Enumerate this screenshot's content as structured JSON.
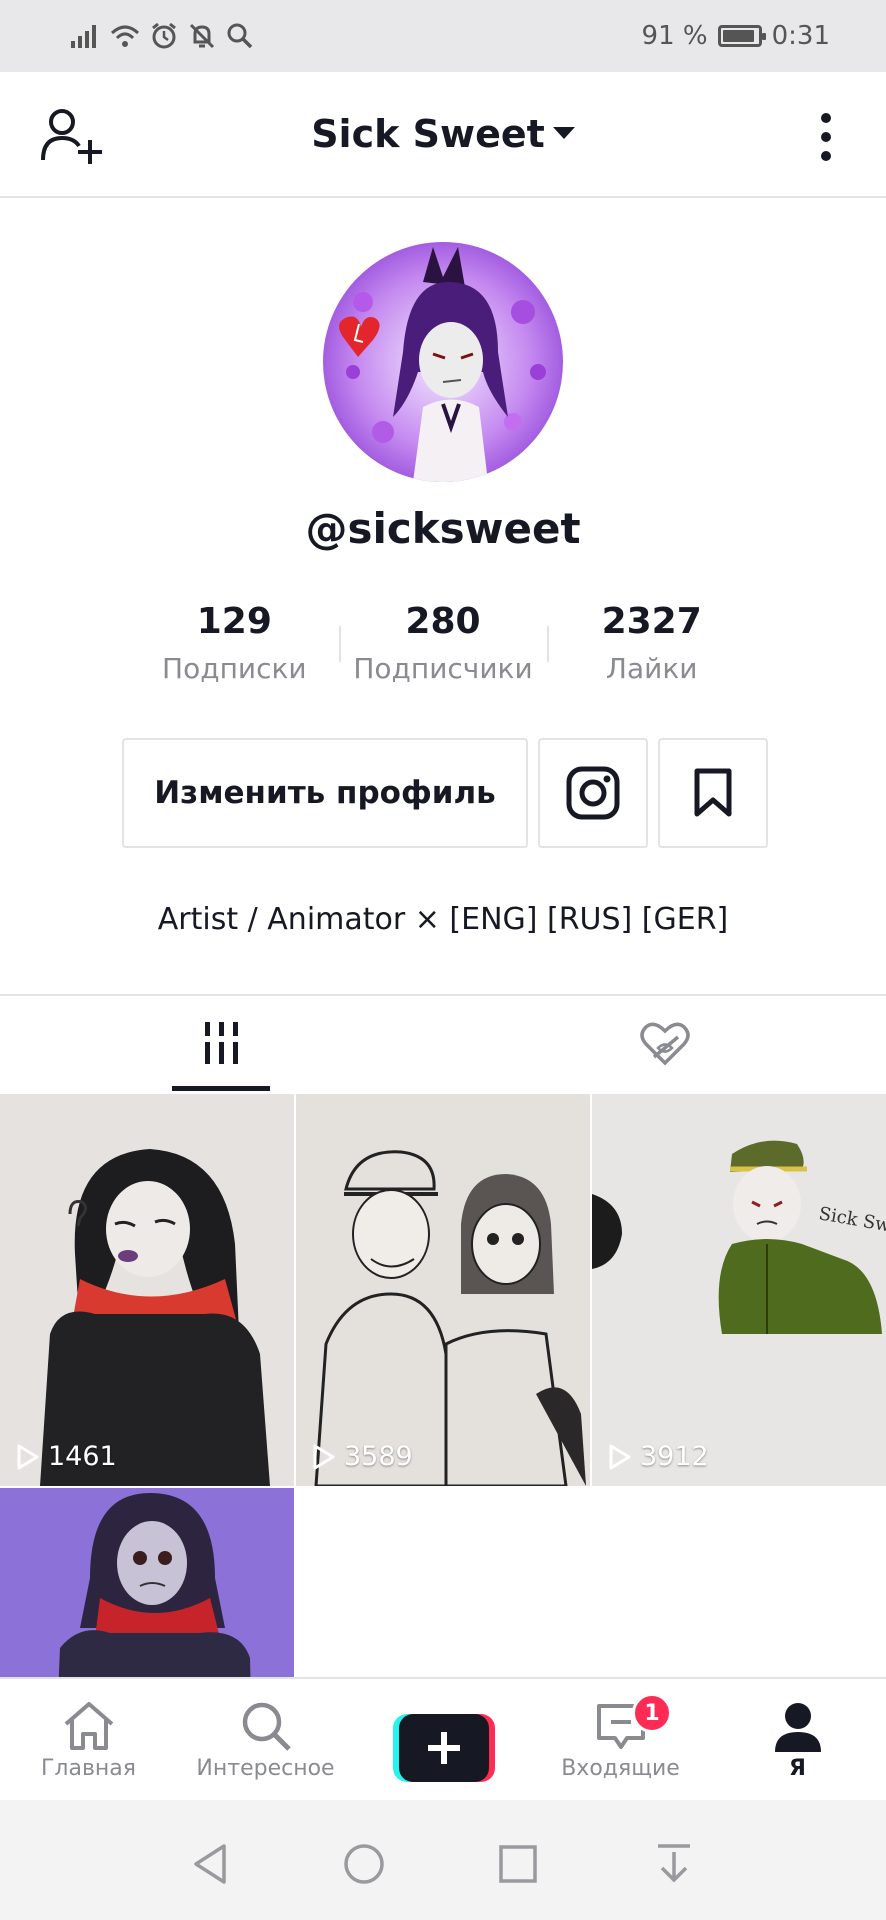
{
  "status_bar": {
    "battery": "91 %",
    "battery_level": 0.91,
    "time": "0:31"
  },
  "header": {
    "title": "Sick Sweet"
  },
  "profile": {
    "username": "@sicksweet",
    "stats": [
      {
        "value": "129",
        "label": "Подписки"
      },
      {
        "value": "280",
        "label": "Подписчики"
      },
      {
        "value": "2327",
        "label": "Лайки"
      }
    ],
    "edit_button": "Изменить профиль",
    "bio": "Artist / Animator × [ENG] [RUS] [GER]"
  },
  "videos": [
    {
      "views": "1461",
      "bg": "#e6e2df"
    },
    {
      "views": "3589",
      "bg": "#e4e1dc"
    },
    {
      "views": "3912",
      "bg": "#e8e6e4"
    },
    {
      "views": "",
      "bg": "#8c72d8"
    }
  ],
  "bottom_nav": {
    "items": [
      {
        "label": "Главная",
        "icon": "home-icon"
      },
      {
        "label": "Интересное",
        "icon": "search-icon"
      },
      {
        "label": "Входящие",
        "icon": "inbox-icon"
      },
      {
        "label": "Я",
        "icon": "profile-icon"
      }
    ],
    "inbox_badge": "1"
  },
  "colors": {
    "accent_pink": "#fe2c55",
    "accent_cyan": "#25f4ee",
    "text_primary": "#161823",
    "text_secondary": "#8a8b91"
  }
}
